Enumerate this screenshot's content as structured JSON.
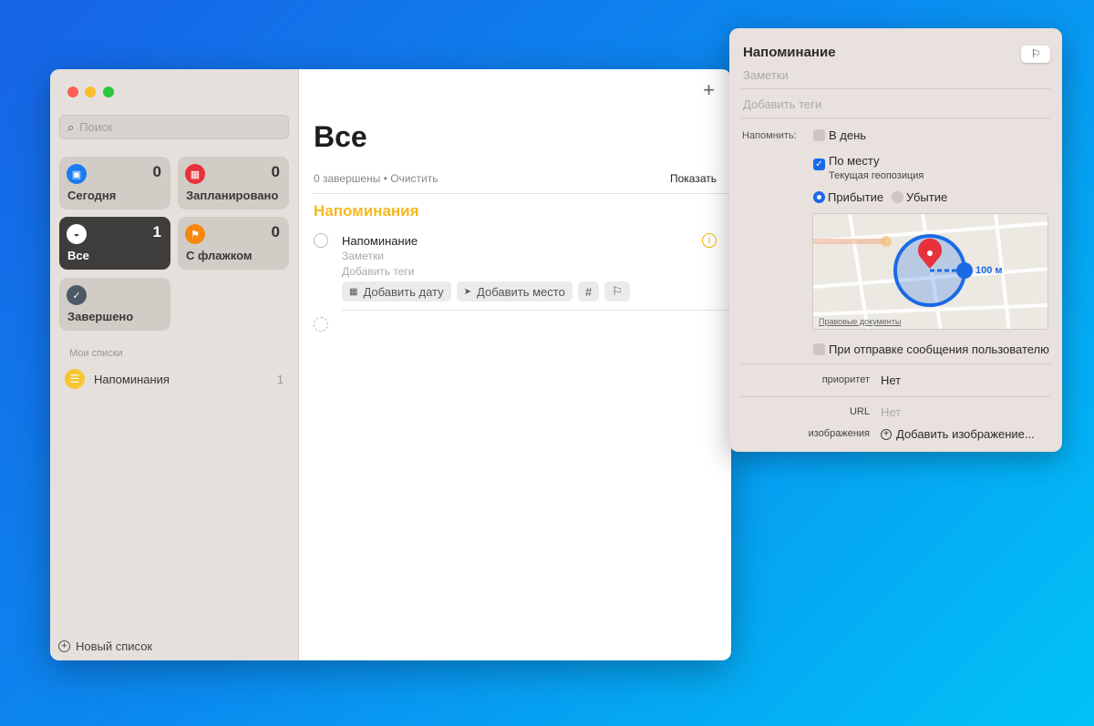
{
  "sidebar": {
    "search_placeholder": "Поиск",
    "cards": [
      {
        "label": "Сегодня",
        "count": "0",
        "color": "#1a7cf0",
        "icon": "calendar-today-icon"
      },
      {
        "label": "Запланировано",
        "count": "0",
        "color": "#e8313a",
        "icon": "calendar-icon"
      },
      {
        "label": "Все",
        "count": "1",
        "color": "#ffffff",
        "icon": "tray-icon"
      },
      {
        "label": "С флажком",
        "count": "0",
        "color": "#f5890f",
        "icon": "flag-icon"
      },
      {
        "label": "Завершено",
        "count": "",
        "color": "#4d5965",
        "icon": "checkmark-icon"
      }
    ],
    "my_lists_header": "Мои списки",
    "lists": [
      {
        "name": "Напоминания",
        "count": "1",
        "color": "#f7c531"
      }
    ],
    "new_list": "Новый список"
  },
  "main": {
    "title": "Все",
    "completed": "0 завершены",
    "dot": "•",
    "clear": "Очистить",
    "show": "Показать",
    "section": "Напоминания",
    "reminder": {
      "title": "Напоминание",
      "notes": "Заметки",
      "tags": "Добавить теги",
      "add_date": "Добавить дату",
      "add_place": "Добавить место",
      "hash": "#"
    },
    "add": "+"
  },
  "popover": {
    "title": "Напоминание",
    "notes": "Заметки",
    "tags": "Добавить теги",
    "remind_label": "Напомнить:",
    "on_day": "В день",
    "on_day_checked": false,
    "by_place": "По месту",
    "by_place_checked": true,
    "location": "Текущая геопозиция",
    "arrival": "Прибытие",
    "departure": "Убытие",
    "selected": "arrival",
    "radius": "100 м",
    "legal": "Правовые документы",
    "messaging": "При отправке сообщения пользователю",
    "priority_label": "приоритет",
    "priority_value": "Нет",
    "url_label": "URL",
    "url_value": "Нет",
    "images_label": "изображения",
    "add_image": "Добавить изображение..."
  }
}
